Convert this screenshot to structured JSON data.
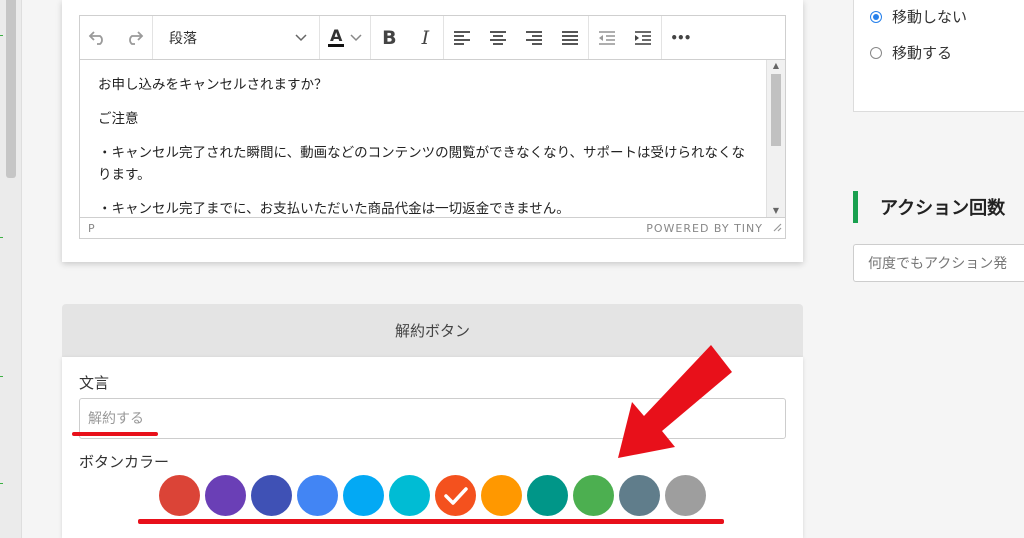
{
  "editor": {
    "toolbar": {
      "undo_icon": "undo-icon",
      "redo_icon": "redo-icon",
      "block_format": "段落",
      "font_color_label": "A",
      "bold_label": "B",
      "italic_label": "I",
      "more_label": "•••"
    },
    "content": [
      "お申し込みをキャンセルされますか？",
      "ご注意",
      "・キャンセル完了された瞬間に、動画などのコンテンツの閲覧ができなくなり、サポートは受けられなくなります。",
      "・キャンセル完了までに、お支払いただいた商品代金は一切返金できません。"
    ],
    "status_path": "P",
    "powered_by": "POWERED BY TINY"
  },
  "cancel_section": {
    "header": "解約ボタン",
    "wording_label": "文言",
    "wording_placeholder": "解約する",
    "color_label": "ボタンカラー",
    "colors": [
      "#db4437",
      "#6a3fb6",
      "#3f51b5",
      "#4285f4",
      "#03a9f4",
      "#00bcd4",
      "#f4511e",
      "#ff9800",
      "#009688",
      "#4caf50",
      "#607d8b",
      "#9e9e9e"
    ],
    "selected_color_index": 6
  },
  "annotation": {
    "color": "#e8101a"
  },
  "right_panel": {
    "radio_options": [
      {
        "label": "移動しない",
        "checked": true
      },
      {
        "label": "移動する",
        "checked": false
      }
    ],
    "action_title": "アクション回数",
    "action_select_value": "何度でもアクション発"
  }
}
